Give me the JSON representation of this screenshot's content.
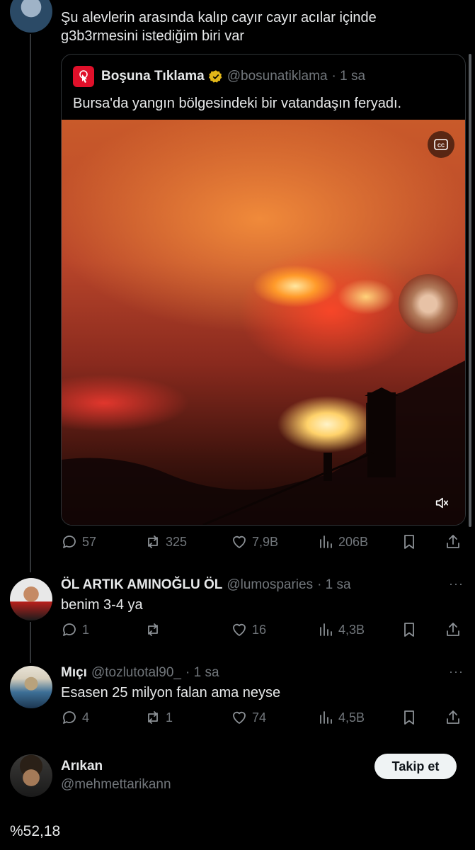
{
  "main_reply": {
    "text_line1": "Şu alevlerin arasında kalıp cayır cayır acılar içinde",
    "text_line2": "g3b3rmesini istediğim biri var"
  },
  "quote": {
    "name": "Boşuna Tıklama",
    "handle": "@bosunatiklama",
    "time": "· 1 sa",
    "text": "Bursa'da yangın bölgesindeki bir vatandaşın feryadı."
  },
  "main_actions": {
    "replies": "57",
    "reposts": "325",
    "likes": "7,9B",
    "views": "206B"
  },
  "reply1": {
    "name": "ÖL ARTIK AMINOĞLU ÖL",
    "handle": "@lumosparies",
    "time": "· 1 sa",
    "text": "benim 3-4 ya",
    "replies": "1",
    "reposts": "",
    "likes": "16",
    "views": "4,3B"
  },
  "reply2": {
    "name": "Mıçı",
    "handle": "@tozlutotal90_",
    "time": "· 1 sa",
    "text": "Esasen 25 milyon falan ama neyse",
    "replies": "4",
    "reposts": "1",
    "likes": "74",
    "views": "4,5B"
  },
  "profile": {
    "name": "Arıkan",
    "handle": "@mehmettarikann",
    "follow_label": "Takip et"
  },
  "footer_text": "%52,18",
  "colors": {
    "background": "#000000",
    "muted": "#71767b",
    "verified": "#e2b719",
    "brand_red": "#e0102a"
  }
}
